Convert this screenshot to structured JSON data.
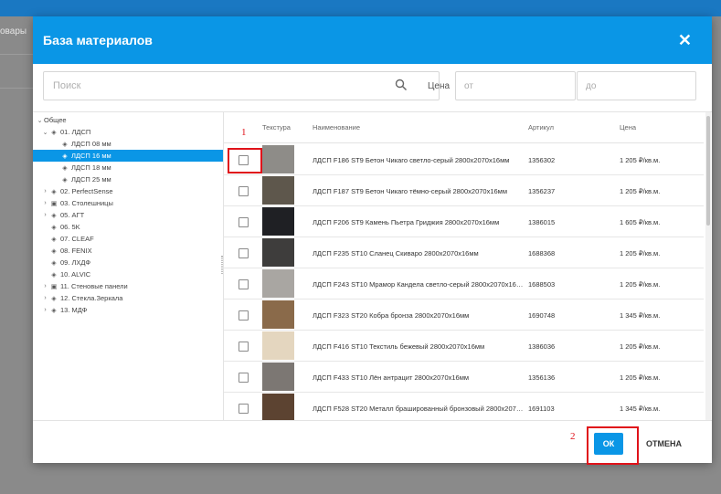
{
  "background": {
    "left_text": "овары"
  },
  "dialog": {
    "title": "База материалов",
    "close_icon": "close-icon",
    "search": {
      "placeholder": "Поиск",
      "icon": "search-icon"
    },
    "price": {
      "label": "Цена",
      "from_placeholder": "от",
      "to_placeholder": "до"
    }
  },
  "tree": [
    {
      "label": "Общее",
      "toggle": "⌄",
      "icon": "",
      "indent": 0
    },
    {
      "label": "01. ЛДСП",
      "toggle": "⌄",
      "icon": "◈",
      "indent": 1
    },
    {
      "label": "ЛДСП 08 мм",
      "toggle": "",
      "icon": "◈",
      "indent": 3
    },
    {
      "label": "ЛДСП 16 мм",
      "toggle": "",
      "icon": "◈",
      "indent": 3,
      "selected": true
    },
    {
      "label": "ЛДСП 18 мм",
      "toggle": "",
      "icon": "◈",
      "indent": 3
    },
    {
      "label": "ЛДСП 25 мм",
      "toggle": "",
      "icon": "◈",
      "indent": 3
    },
    {
      "label": "02. PerfectSense",
      "toggle": "›",
      "icon": "◈",
      "indent": 1
    },
    {
      "label": "03. Столешницы",
      "toggle": "›",
      "icon": "▣",
      "indent": 1
    },
    {
      "label": "05. АГТ",
      "toggle": "›",
      "icon": "◈",
      "indent": 1
    },
    {
      "label": "06. 5K",
      "toggle": "",
      "icon": "◈",
      "indent": 1
    },
    {
      "label": "07. CLEAF",
      "toggle": "",
      "icon": "◈",
      "indent": 1
    },
    {
      "label": "08. FENIX",
      "toggle": "",
      "icon": "◈",
      "indent": 1
    },
    {
      "label": "09. ЛХДФ",
      "toggle": "",
      "icon": "◈",
      "indent": 1
    },
    {
      "label": "10. ALVIC",
      "toggle": "",
      "icon": "◈",
      "indent": 1
    },
    {
      "label": "11. Стеновые панели",
      "toggle": "›",
      "icon": "▣",
      "indent": 1
    },
    {
      "label": "12. Стекла.Зеркала",
      "toggle": "›",
      "icon": "◈",
      "indent": 1
    },
    {
      "label": "13. МДФ",
      "toggle": "›",
      "icon": "◈",
      "indent": 1
    }
  ],
  "table": {
    "headers": {
      "texture": "Текстура",
      "name": "Наименование",
      "article": "Артикул",
      "price": "Цена"
    },
    "rows": [
      {
        "name": "ЛДСП F186 ST9 Бетон Чикаго светло-серый 2800x2070x16мм",
        "article": "1356302",
        "price": "1 205 ₽/кв.м.",
        "swatch": "#8e8c88"
      },
      {
        "name": "ЛДСП F187 ST9 Бетон Чикаго тёмно-серый 2800x2070x16мм",
        "article": "1356237",
        "price": "1 205 ₽/кв.м.",
        "swatch": "#5e574c"
      },
      {
        "name": "ЛДСП F206 ST9 Камень Пьетра Гриджия 2800x2070x16мм",
        "article": "1386015",
        "price": "1 605 ₽/кв.м.",
        "swatch": "#1f2024"
      },
      {
        "name": "ЛДСП F235 ST10 Сланец Скиваро 2800x2070x16мм",
        "article": "1688368",
        "price": "1 205 ₽/кв.м.",
        "swatch": "#3e3d3c"
      },
      {
        "name": "ЛДСП F243 ST10 Мрамор Кандела светло-серый 2800x2070x16мм",
        "article": "1688503",
        "price": "1 205 ₽/кв.м.",
        "swatch": "#a9a6a2"
      },
      {
        "name": "ЛДСП F323 ST20 Кобра бронза 2800x2070x16мм",
        "article": "1690748",
        "price": "1 345 ₽/кв.м.",
        "swatch": "#8a6a4a"
      },
      {
        "name": "ЛДСП F416 ST10 Текстиль бежевый 2800x2070x16мм",
        "article": "1386036",
        "price": "1 205 ₽/кв.м.",
        "swatch": "#e4d6bf"
      },
      {
        "name": "ЛДСП F433 ST10 Лён антрацит 2800x2070x16мм",
        "article": "1356136",
        "price": "1 205 ₽/кв.м.",
        "swatch": "#7c7773"
      },
      {
        "name": "ЛДСП F528 ST20 Металл брашированный бронзовый 2800x2070x16мм",
        "article": "1691103",
        "price": "1 345 ₽/кв.м.",
        "swatch": "#5c4331"
      }
    ]
  },
  "footer": {
    "ok_label": "ОК",
    "cancel_label": "ОТМЕНА"
  },
  "annotations": {
    "one": "1",
    "two": "2"
  },
  "colors": {
    "accent": "#0a96e6",
    "annotation": "#e0121a"
  }
}
